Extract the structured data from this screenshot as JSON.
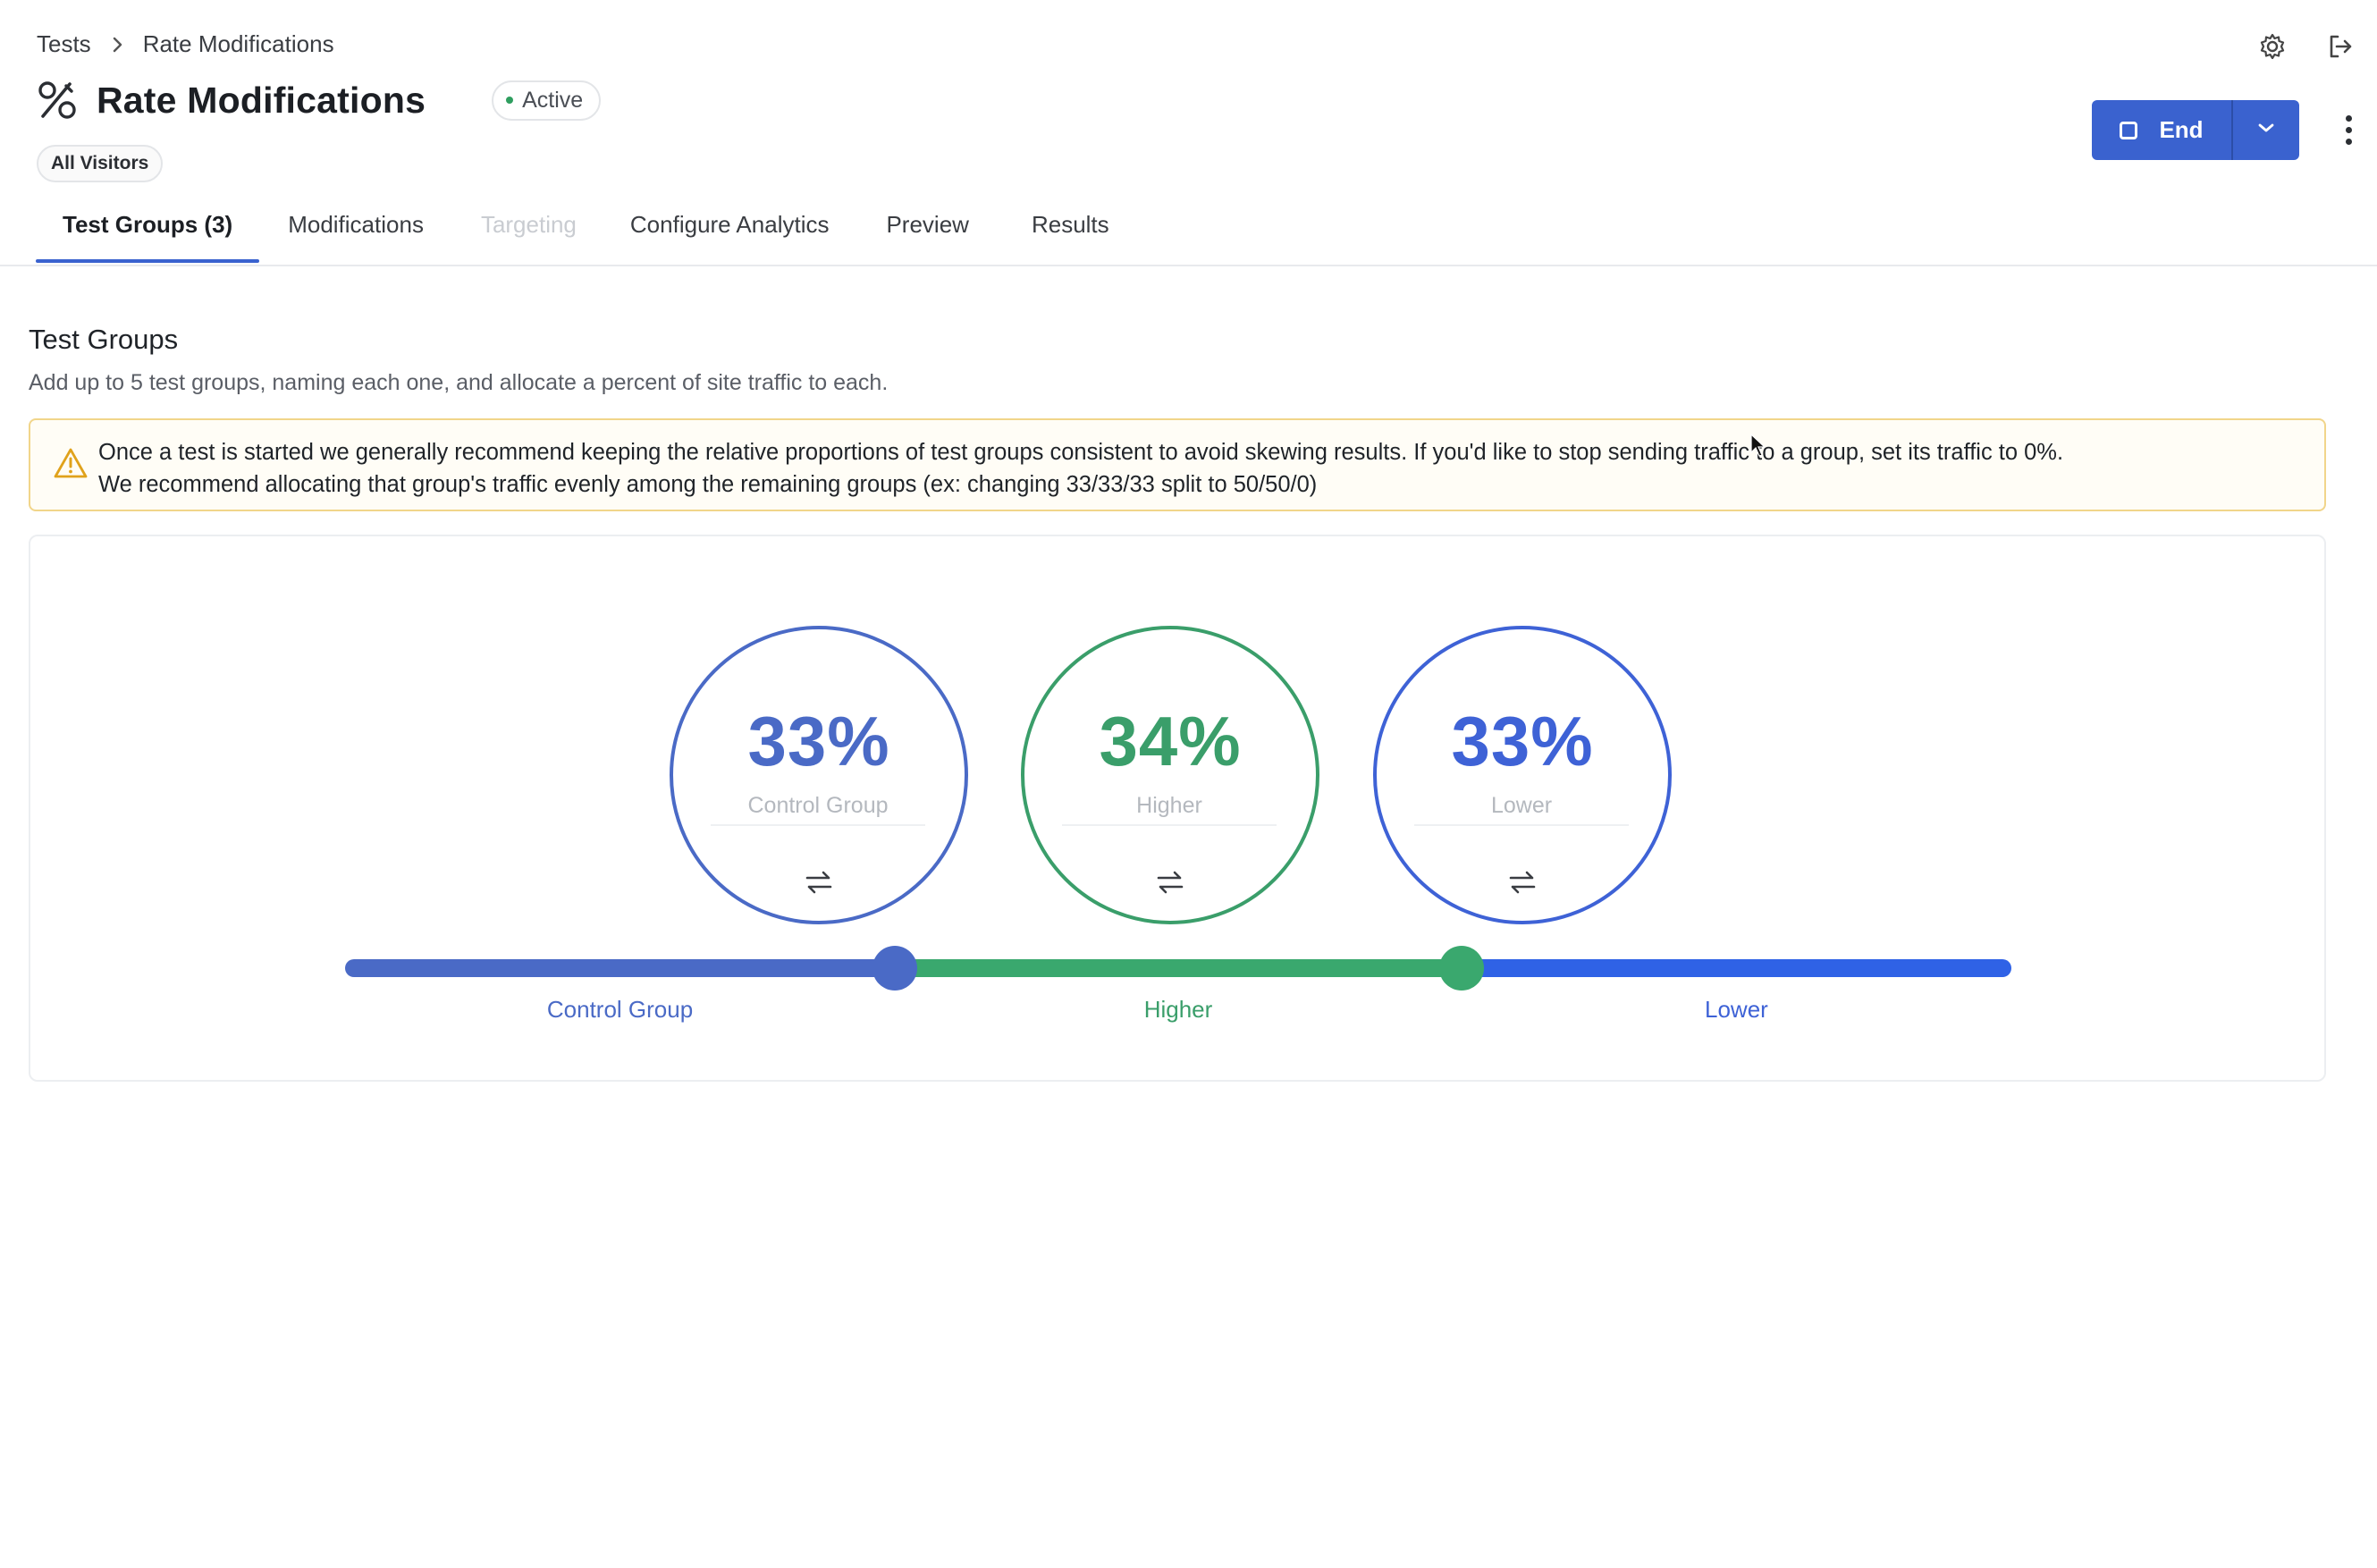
{
  "breadcrumb": {
    "parent": "Tests",
    "current": "Rate Modifications"
  },
  "header": {
    "title": "Rate Modifications",
    "status": "Active",
    "audience": "All Visitors",
    "end_label": "End"
  },
  "tabs": [
    {
      "label": "Test Groups (3)",
      "state": "active"
    },
    {
      "label": "Modifications",
      "state": "normal"
    },
    {
      "label": "Targeting",
      "state": "disabled"
    },
    {
      "label": "Configure Analytics",
      "state": "normal"
    },
    {
      "label": "Preview",
      "state": "normal"
    },
    {
      "label": "Results",
      "state": "normal"
    }
  ],
  "section": {
    "title": "Test Groups",
    "description": "Add up to 5 test groups, naming each one, and allocate a percent of site traffic to each.",
    "warning_line1": "Once a test is started we generally recommend keeping the relative proportions of test groups consistent to avoid skewing results. If you'd like to stop sending traffic to a group, set its traffic to 0%.",
    "warning_line2": "We recommend allocating that group's traffic evenly among the remaining groups (ex: changing 33/33/33 split to 50/50/0)"
  },
  "groups": [
    {
      "name": "Control Group",
      "percent": "33%",
      "value": 33,
      "color": "#4a6ac6",
      "track_color": "#4a6ac6"
    },
    {
      "name": "Higher",
      "percent": "34%",
      "value": 34,
      "color": "#3a9e6a",
      "track_color": "#3aa86e"
    },
    {
      "name": "Lower",
      "percent": "33%",
      "value": 33,
      "color": "#3e62d6",
      "track_color": "#2f62e6"
    }
  ],
  "icons": {
    "title": "percent-icon",
    "settings": "gear-icon",
    "logout": "logout-icon",
    "warning": "warning-icon",
    "swap": "swap-icon"
  }
}
